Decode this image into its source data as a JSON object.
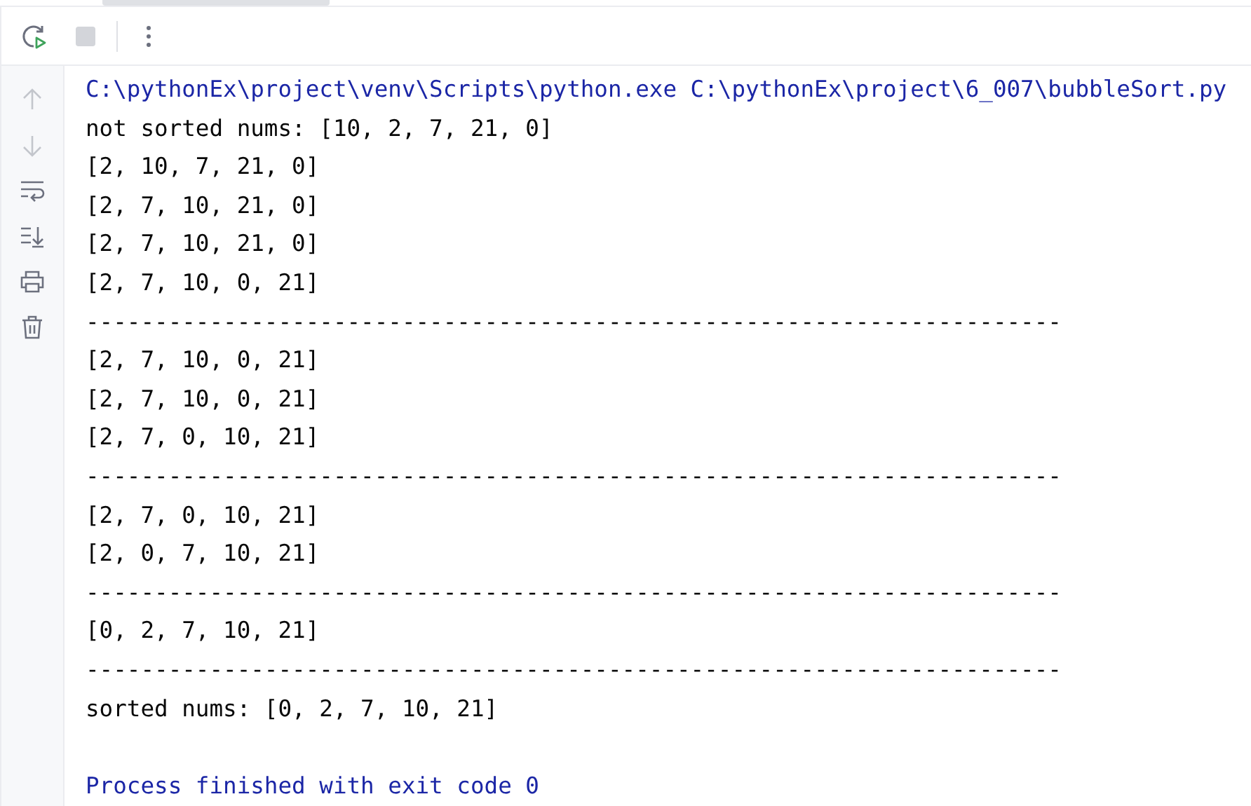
{
  "toolbar": {
    "buttons": [
      {
        "kind": "rerun",
        "disabled": false
      },
      {
        "kind": "stop",
        "disabled": true
      },
      {
        "kind": "more",
        "disabled": false
      }
    ]
  },
  "gutter": {
    "buttons": [
      {
        "kind": "up",
        "disabled": true
      },
      {
        "kind": "down",
        "disabled": true
      },
      {
        "kind": "wrap",
        "disabled": false
      },
      {
        "kind": "scroll-end",
        "disabled": false
      },
      {
        "kind": "print",
        "disabled": false
      },
      {
        "kind": "clear",
        "disabled": false
      }
    ]
  },
  "console": {
    "lines": [
      {
        "kind": "system",
        "text": "C:\\pythonEx\\project\\venv\\Scripts\\python.exe C:\\pythonEx\\project\\6_007\\bubbleSort.py"
      },
      {
        "kind": "output",
        "text": "not sorted nums: [10, 2, 7, 21, 0]"
      },
      {
        "kind": "output",
        "text": "[2, 10, 7, 21, 0]"
      },
      {
        "kind": "output",
        "text": "[2, 7, 10, 21, 0]"
      },
      {
        "kind": "output",
        "text": "[2, 7, 10, 21, 0]"
      },
      {
        "kind": "output",
        "text": "[2, 7, 10, 0, 21]"
      },
      {
        "kind": "output",
        "text": "-----------------------------------------------------------------------"
      },
      {
        "kind": "output",
        "text": "[2, 7, 10, 0, 21]"
      },
      {
        "kind": "output",
        "text": "[2, 7, 10, 0, 21]"
      },
      {
        "kind": "output",
        "text": "[2, 7, 0, 10, 21]"
      },
      {
        "kind": "output",
        "text": "-----------------------------------------------------------------------"
      },
      {
        "kind": "output",
        "text": "[2, 7, 0, 10, 21]"
      },
      {
        "kind": "output",
        "text": "[2, 0, 7, 10, 21]"
      },
      {
        "kind": "output",
        "text": "-----------------------------------------------------------------------"
      },
      {
        "kind": "output",
        "text": "[0, 2, 7, 10, 21]"
      },
      {
        "kind": "output",
        "text": "-----------------------------------------------------------------------"
      },
      {
        "kind": "output",
        "text": "sorted nums: [0, 2, 7, 10, 21]"
      },
      {
        "kind": "blank"
      },
      {
        "kind": "system",
        "text": "Process finished with exit code 0"
      }
    ]
  }
}
